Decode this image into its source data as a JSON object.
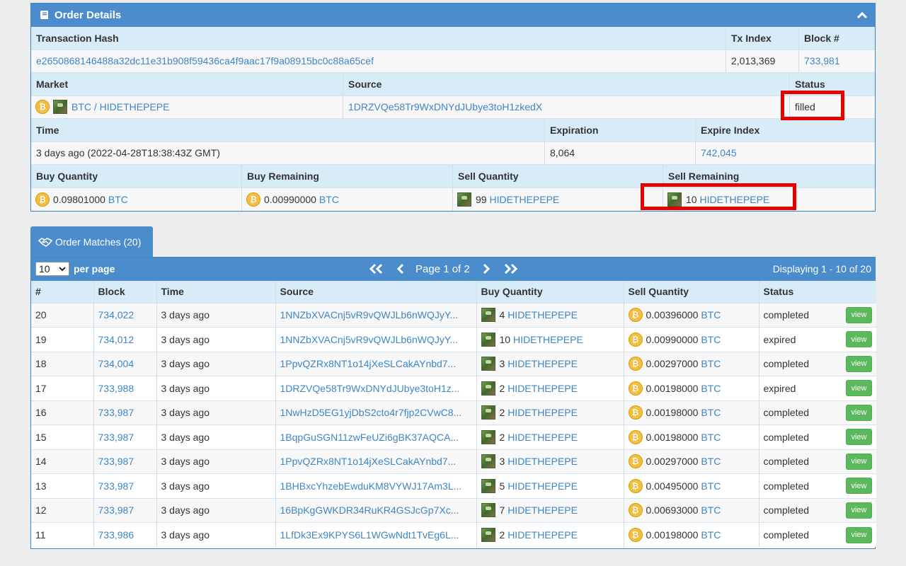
{
  "order_details": {
    "title": "Order Details",
    "tx_hash_label": "Transaction Hash",
    "tx_hash": "e2650868146488a32dc11e31b908f59436ca4f9aac17f9a08915bc0c88a65cef",
    "tx_index_label": "Tx Index",
    "tx_index": "2,013,369",
    "block_label": "Block #",
    "block": "733,981",
    "market_label": "Market",
    "market": "BTC / HIDETHEPEPE",
    "source_label": "Source",
    "source": "1DRZVQe58Tr9WxDNYdJUbye3toH1zkedX",
    "status_label": "Status",
    "status": "filled",
    "time_label": "Time",
    "time": "3 days ago (2022-04-28T18:38:43Z GMT)",
    "expiration_label": "Expiration",
    "expiration": "8,064",
    "expire_index_label": "Expire Index",
    "expire_index": "742,045",
    "buy_quantity_label": "Buy Quantity",
    "buy_quantity": "0.09801000",
    "buy_quantity_asset": "BTC",
    "buy_remaining_label": "Buy Remaining",
    "buy_remaining": "0.00990000",
    "buy_remaining_asset": "BTC",
    "sell_quantity_label": "Sell Quantity",
    "sell_quantity": "99",
    "sell_quantity_asset": "HIDETHEPEPE",
    "sell_remaining_label": "Sell Remaining",
    "sell_remaining": "10",
    "sell_remaining_asset": "HIDETHEPEPE"
  },
  "order_matches": {
    "tab_label": "Order Matches (20)",
    "per_page_value": "10",
    "per_page_label": "per page",
    "page_label": "Page 1 of 2",
    "display_info": "Displaying 1 - 10 of 20",
    "columns": [
      "#",
      "Block",
      "Time",
      "Source",
      "Buy Quantity",
      "Sell Quantity",
      "Status"
    ],
    "view_label": "view",
    "rows": [
      {
        "num": "20",
        "block": "734,022",
        "time": "3 days ago",
        "source": "1NNZbXVACnj5vR9vQWJLb6nWQJyY...",
        "buy_qty": "4",
        "buy_asset": "HIDETHEPEPE",
        "sell_qty": "0.00396000",
        "sell_asset": "BTC",
        "status": "completed"
      },
      {
        "num": "19",
        "block": "734,012",
        "time": "3 days ago",
        "source": "1NNZbXVACnj5vR9vQWJLb6nWQJyY...",
        "buy_qty": "10",
        "buy_asset": "HIDETHEPEPE",
        "sell_qty": "0.00990000",
        "sell_asset": "BTC",
        "status": "expired"
      },
      {
        "num": "18",
        "block": "734,004",
        "time": "3 days ago",
        "source": "1PpvQZRx8NT1o14jXeSLCakAYnbd7...",
        "buy_qty": "3",
        "buy_asset": "HIDETHEPEPE",
        "sell_qty": "0.00297000",
        "sell_asset": "BTC",
        "status": "completed"
      },
      {
        "num": "17",
        "block": "733,988",
        "time": "3 days ago",
        "source": "1DRZVQe58Tr9WxDNYdJUbye3toH1z...",
        "buy_qty": "2",
        "buy_asset": "HIDETHEPEPE",
        "sell_qty": "0.00198000",
        "sell_asset": "BTC",
        "status": "expired"
      },
      {
        "num": "16",
        "block": "733,987",
        "time": "3 days ago",
        "source": "1NwHzD5EG1yjDbS2cto4r7fjp2CVwC8...",
        "buy_qty": "2",
        "buy_asset": "HIDETHEPEPE",
        "sell_qty": "0.00198000",
        "sell_asset": "BTC",
        "status": "completed"
      },
      {
        "num": "15",
        "block": "733,987",
        "time": "3 days ago",
        "source": "1BqpGuSGN11zwFeUZi6gBK37AQCA...",
        "buy_qty": "2",
        "buy_asset": "HIDETHEPEPE",
        "sell_qty": "0.00198000",
        "sell_asset": "BTC",
        "status": "completed"
      },
      {
        "num": "14",
        "block": "733,987",
        "time": "3 days ago",
        "source": "1PpvQZRx8NT1o14jXeSLCakAYnbd7...",
        "buy_qty": "3",
        "buy_asset": "HIDETHEPEPE",
        "sell_qty": "0.00297000",
        "sell_asset": "BTC",
        "status": "completed"
      },
      {
        "num": "13",
        "block": "733,987",
        "time": "3 days ago",
        "source": "1BHBxcYhzebEwduKM8VYWJ17Am3L...",
        "buy_qty": "5",
        "buy_asset": "HIDETHEPEPE",
        "sell_qty": "0.00495000",
        "sell_asset": "BTC",
        "status": "completed"
      },
      {
        "num": "12",
        "block": "733,987",
        "time": "3 days ago",
        "source": "16BpKgGWKDR34RuKR4GSJcGp7Xc...",
        "buy_qty": "7",
        "buy_asset": "HIDETHEPEPE",
        "sell_qty": "0.00693000",
        "sell_asset": "BTC",
        "status": "completed"
      },
      {
        "num": "11",
        "block": "733,986",
        "time": "3 days ago",
        "source": "1LfDk3Ex9KPYS6L1WGwNdt1TvEg6L...",
        "buy_qty": "2",
        "buy_asset": "HIDETHEPEPE",
        "sell_qty": "0.00198000",
        "sell_asset": "BTC",
        "status": "completed"
      }
    ]
  },
  "icons": {
    "order_details": "book-icon",
    "collapse": "chevron-up-icon",
    "matches": "handshake-icon",
    "btc": "bitcoin-coin-icon",
    "pepe": "hidethepepe-asset-icon"
  },
  "colors": {
    "header_blue": "#4a8ccc",
    "header_row": "#d7ecf7",
    "link": "#3d86c6",
    "view_green": "#5cb85c",
    "highlight_red": "#e60000",
    "btc_gold": "#f5bf3a"
  }
}
